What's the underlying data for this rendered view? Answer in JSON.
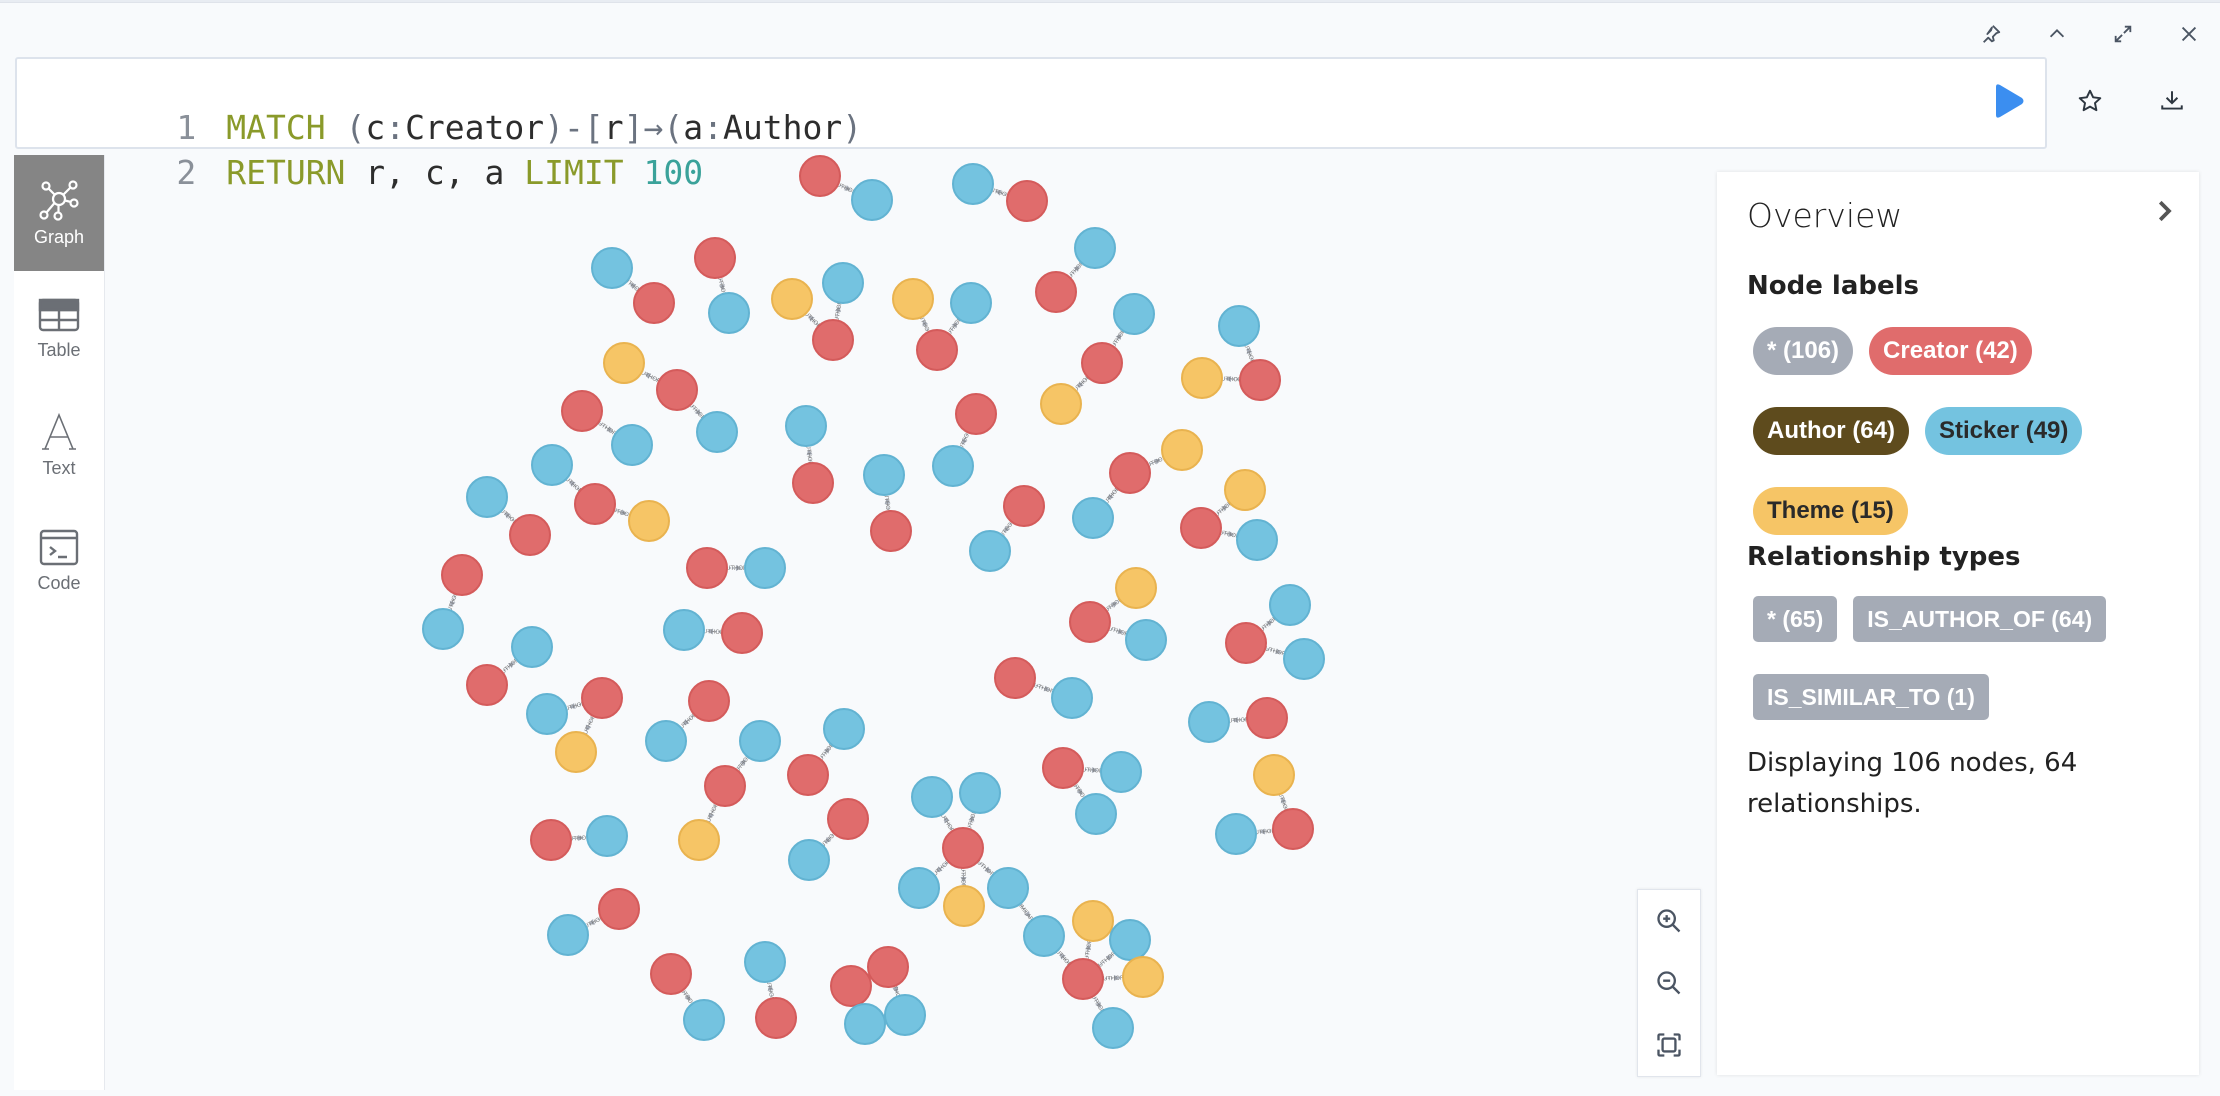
{
  "window_controls": {
    "pin": "pin-icon",
    "collapse": "chevron-up-icon",
    "fullscreen": "expand-icon",
    "close": "close-icon"
  },
  "editor": {
    "lines": [
      {
        "number": "1",
        "tokens": [
          {
            "t": "MATCH",
            "c": "kw"
          },
          {
            "t": " ",
            "c": "id"
          },
          {
            "t": "(",
            "c": "pun"
          },
          {
            "t": "c",
            "c": "id"
          },
          {
            "t": ":",
            "c": "pun"
          },
          {
            "t": "Creator",
            "c": "id"
          },
          {
            "t": ")-[",
            "c": "pun"
          },
          {
            "t": "r",
            "c": "id"
          },
          {
            "t": "]→(",
            "c": "pun"
          },
          {
            "t": "a",
            "c": "id"
          },
          {
            "t": ":",
            "c": "pun"
          },
          {
            "t": "Author",
            "c": "id"
          },
          {
            "t": ")",
            "c": "pun"
          }
        ]
      },
      {
        "number": "2",
        "tokens": [
          {
            "t": "RETURN",
            "c": "kw"
          },
          {
            "t": " r, c, a ",
            "c": "id"
          },
          {
            "t": "LIMIT",
            "c": "kw"
          },
          {
            "t": " ",
            "c": "id"
          },
          {
            "t": "100",
            "c": "num"
          }
        ]
      }
    ],
    "run_icon": "play-icon",
    "favorite_icon": "star-icon",
    "download_icon": "download-icon"
  },
  "sidebar": {
    "items": [
      {
        "label": "Graph",
        "icon": "graph-icon",
        "active": true
      },
      {
        "label": "Table",
        "icon": "table-icon",
        "active": false
      },
      {
        "label": "Text",
        "icon": "text-icon",
        "active": false
      },
      {
        "label": "Code",
        "icon": "code-icon",
        "active": false
      }
    ]
  },
  "overview": {
    "title": "Overview",
    "node_labels_title": "Node labels",
    "node_labels": [
      {
        "label": "* (106)",
        "bg": "#a5abb6",
        "fg": "#ffffff"
      },
      {
        "label": "Creator (42)",
        "bg": "#e06c6c",
        "fg": "#ffffff"
      },
      {
        "label": "Author (64)",
        "bg": "#5e4b1d",
        "fg": "#ffffff"
      },
      {
        "label": "Sticker (49)",
        "bg": "#74c3e0",
        "fg": "#2a2a2a"
      },
      {
        "label": "Theme (15)",
        "bg": "#f6c566",
        "fg": "#2a2a2a"
      }
    ],
    "relationship_types_title": "Relationship types",
    "relationship_types": [
      {
        "label": "* (65)"
      },
      {
        "label": "IS_AUTHOR_OF (64)"
      },
      {
        "label": "IS_SIMILAR_TO (1)"
      }
    ],
    "summary": "Displaying 106 nodes, 64 relationships."
  },
  "graph": {
    "colors": {
      "Creator": "#e06c6c",
      "Sticker": "#74c3e0",
      "Theme": "#f6c566"
    },
    "relationship_label": "IS_AUTHOR_OF",
    "similar_label": "IS_SIMILAR_TO",
    "zoom_controls": [
      "zoom-in-icon",
      "zoom-out-icon",
      "fit-to-screen-icon"
    ]
  }
}
